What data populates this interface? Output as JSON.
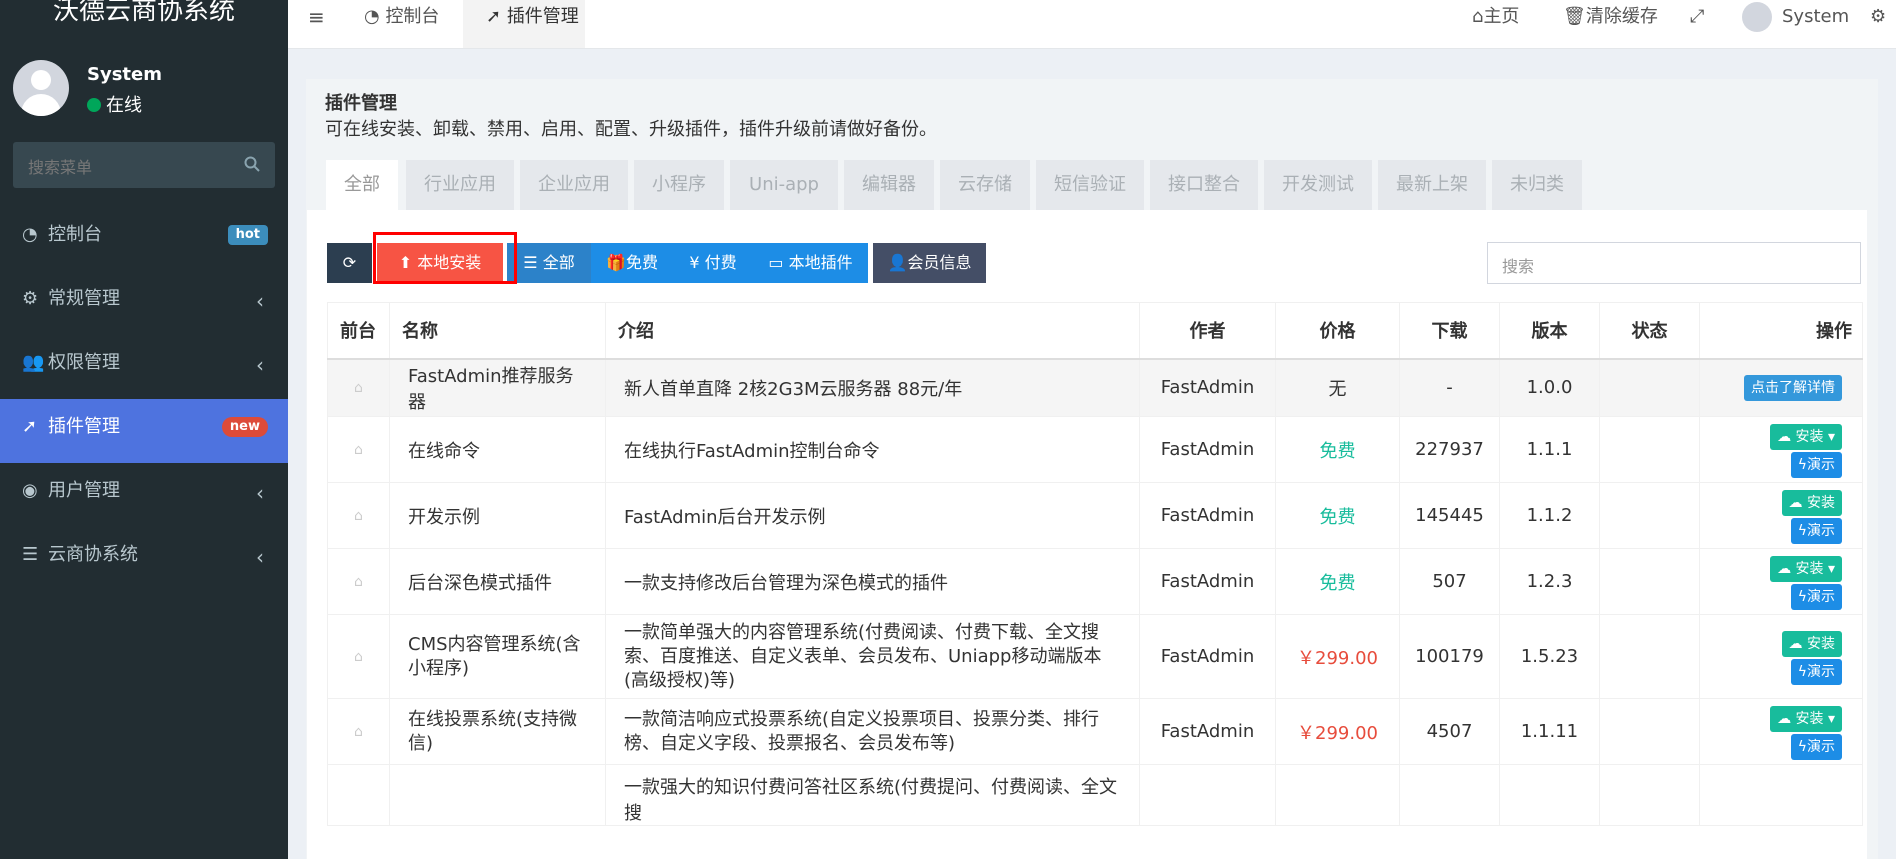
{
  "sidebar": {
    "brand": "沃德云商协系统",
    "user_name": "System",
    "user_status": "在线",
    "search_placeholder": "搜索菜单",
    "items": [
      {
        "label": "控制台",
        "icon": "dashboard-icon",
        "badge": "hot"
      },
      {
        "label": "常规管理",
        "icon": "cogs-icon"
      },
      {
        "label": "权限管理",
        "icon": "group-icon"
      },
      {
        "label": "插件管理",
        "icon": "rocket-icon",
        "badge": "new",
        "active": true
      },
      {
        "label": "用户管理",
        "icon": "user-circle-icon"
      },
      {
        "label": "云商协系统",
        "icon": "list-icon"
      }
    ]
  },
  "topnav": {
    "menu_toggle": "≡",
    "tab_dashboard": "控制台",
    "tab_addon": "插件管理",
    "home": "主页",
    "clear_cache": "清除缓存",
    "user": "System"
  },
  "page": {
    "title": "插件管理",
    "desc": "可在线安装、卸载、禁用、启用、配置、升级插件，插件升级前请做好备份。",
    "categories": [
      "全部",
      "行业应用",
      "企业应用",
      "小程序",
      "Uni-app",
      "编辑器",
      "云存储",
      "短信验证",
      "接口整合",
      "开发测试",
      "最新上架",
      "未归类"
    ]
  },
  "toolbar": {
    "local_install": "本地安装",
    "all": "全部",
    "free": "免费",
    "paid": "付费",
    "local_addon": "本地插件",
    "member_info": "会员信息",
    "search_placeholder": "搜索"
  },
  "table": {
    "headers": [
      "前台",
      "名称",
      "介绍",
      "作者",
      "价格",
      "下载",
      "版本",
      "状态",
      "操作"
    ],
    "rows": [
      {
        "name": "FastAdmin推荐服务器",
        "intro": "新人首单直降 2核2G3M云服务器 88元/年",
        "author": "FastAdmin",
        "price": "无",
        "downloads": "-",
        "version": "1.0.0",
        "action": "点击了解详情"
      },
      {
        "name": "在线命令",
        "intro": "在线执行FastAdmin控制台命令",
        "author": "FastAdmin",
        "price": "免费",
        "downloads": "227937",
        "version": "1.1.1",
        "action": "安装",
        "demo": "演示"
      },
      {
        "name": "开发示例",
        "intro": "FastAdmin后台开发示例",
        "author": "FastAdmin",
        "price": "免费",
        "downloads": "145445",
        "version": "1.1.2",
        "action": "安装",
        "demo": "演示"
      },
      {
        "name": "后台深色模式插件",
        "intro": "一款支持修改后台管理为深色模式的插件",
        "author": "FastAdmin",
        "price": "免费",
        "downloads": "507",
        "version": "1.2.3",
        "action": "安装",
        "demo": "演示"
      },
      {
        "name": "CMS内容管理系统(含小程序)",
        "intro": "一款简单强大的内容管理系统(付费阅读、付费下载、全文搜索、百度推送、自定义表单、会员发布、Uniapp移动端版本(高级授权)等)",
        "author": "FastAdmin",
        "price": "￥299.00",
        "downloads": "100179",
        "version": "1.5.23",
        "action": "安装",
        "demo": "演示"
      },
      {
        "name": "在线投票系统(支持微信)",
        "intro": "一款简洁响应式投票系统(自定义投票项目、投票分类、排行榜、自定义字段、投票报名、会员发布等)",
        "author": "FastAdmin",
        "price": "￥299.00",
        "downloads": "4507",
        "version": "1.1.11",
        "action": "安装",
        "demo": "演示"
      },
      {
        "name": "",
        "intro": "一款强大的知识付费问答社区系统(付费提问、付费阅读、全文搜",
        "author": "",
        "price": "",
        "downloads": "",
        "version": "",
        "action": ""
      }
    ]
  }
}
